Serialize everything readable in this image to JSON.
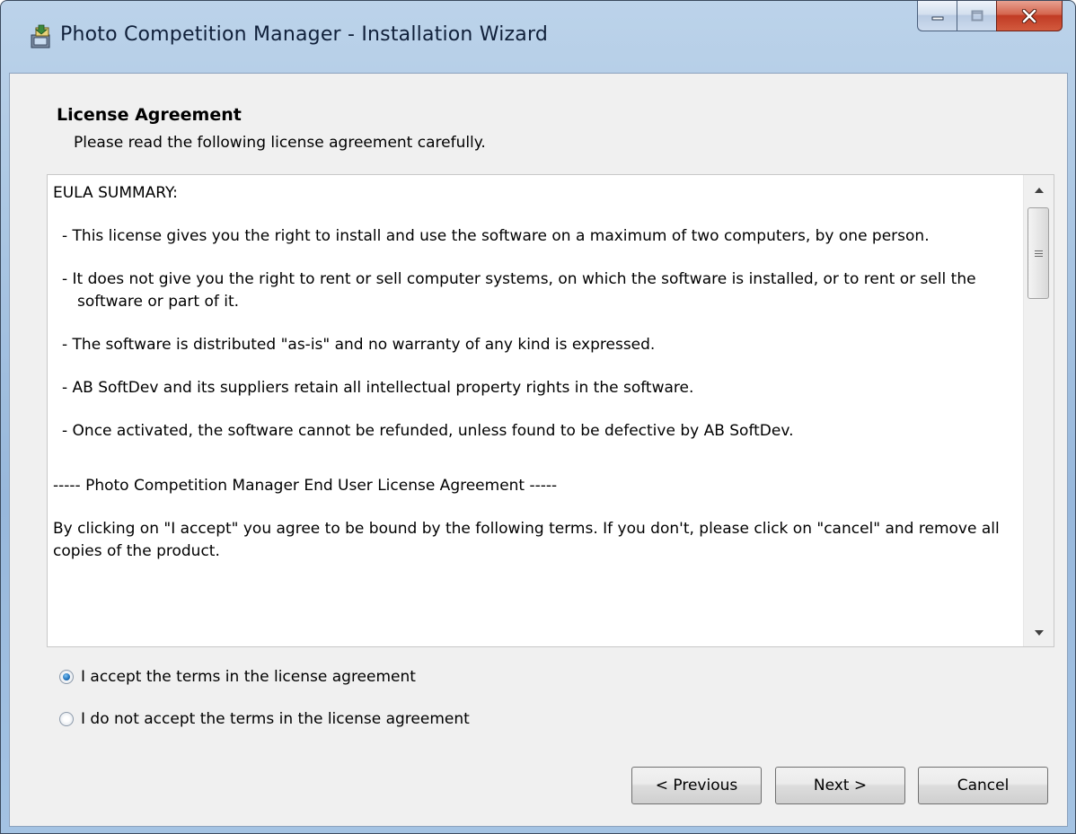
{
  "window": {
    "title": "Photo Competition Manager - Installation Wizard",
    "icons": {
      "app": "installer-icon",
      "minimize": "minimize-icon",
      "maximize": "maximize-icon",
      "close": "close-icon"
    }
  },
  "page": {
    "heading": "License Agreement",
    "subheading": "Please read the following license agreement carefully."
  },
  "license": {
    "paragraphs": [
      "EULA SUMMARY:",
      "- This license gives you the right to install and use the software on a maximum of two computers, by one person.",
      "- It does not give you the right to rent or sell computer systems, on which the software is installed, or to rent or sell the software or part of it.",
      "- The software is distributed \"as-is\" and no warranty of any kind is expressed.",
      "- AB SoftDev and its suppliers retain all intellectual property rights in the software.",
      "- Once activated, the software cannot be refunded, unless found to be defective by AB SoftDev.",
      "----- Photo Competition Manager End User License Agreement -----",
      "By clicking on \"I accept\" you agree to be bound by the following terms. If you don't, please click on \"cancel\" and remove all copies of the product."
    ]
  },
  "options": {
    "accept_label": "I accept the terms in the license agreement",
    "decline_label": "I do not accept the terms in the license agreement",
    "selected": "accept"
  },
  "buttons": {
    "previous": "< Previous",
    "next": "Next >",
    "cancel": "Cancel"
  },
  "colors": {
    "title_bar": "#a9c5e2",
    "client_background": "#f0f0f0",
    "close_button": "#c13b24",
    "radio_selected": "#1e6fb8"
  }
}
